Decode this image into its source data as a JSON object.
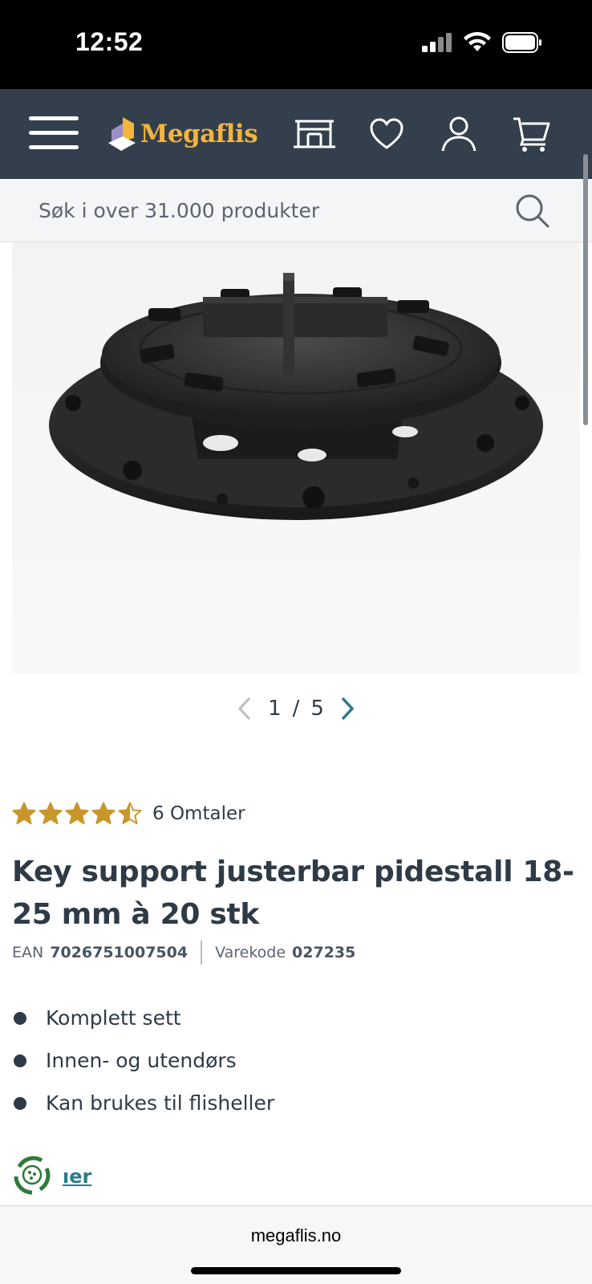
{
  "status_bar": {
    "time": "12:52"
  },
  "header": {
    "logo_text": "Megaflis",
    "icons": [
      "menu-icon",
      "store-icon",
      "heart-icon",
      "user-icon",
      "cart-icon"
    ],
    "colors": {
      "header_bg": "#333f4c",
      "logo": "#f4b53d"
    }
  },
  "search": {
    "placeholder": "Søk i over 31.000 produkter"
  },
  "gallery": {
    "current": "1",
    "separator": "/",
    "total": "5"
  },
  "rating": {
    "stars": 4.5,
    "max": 5,
    "count_label": "6 Omtaler",
    "star_color": "#c99629"
  },
  "product": {
    "title": "Key support justerbar pidestall 18-25 mm à 20 stk",
    "ean_label": "EAN",
    "ean_value": "7026751007504",
    "sku_label": "Varekode",
    "sku_value": "027235",
    "features": [
      "Komplett sett",
      "Innen- og utendørs",
      "Kan brukes til flisheller"
    ],
    "more_link": "ıer"
  },
  "browser": {
    "address": "megaflis.no"
  }
}
